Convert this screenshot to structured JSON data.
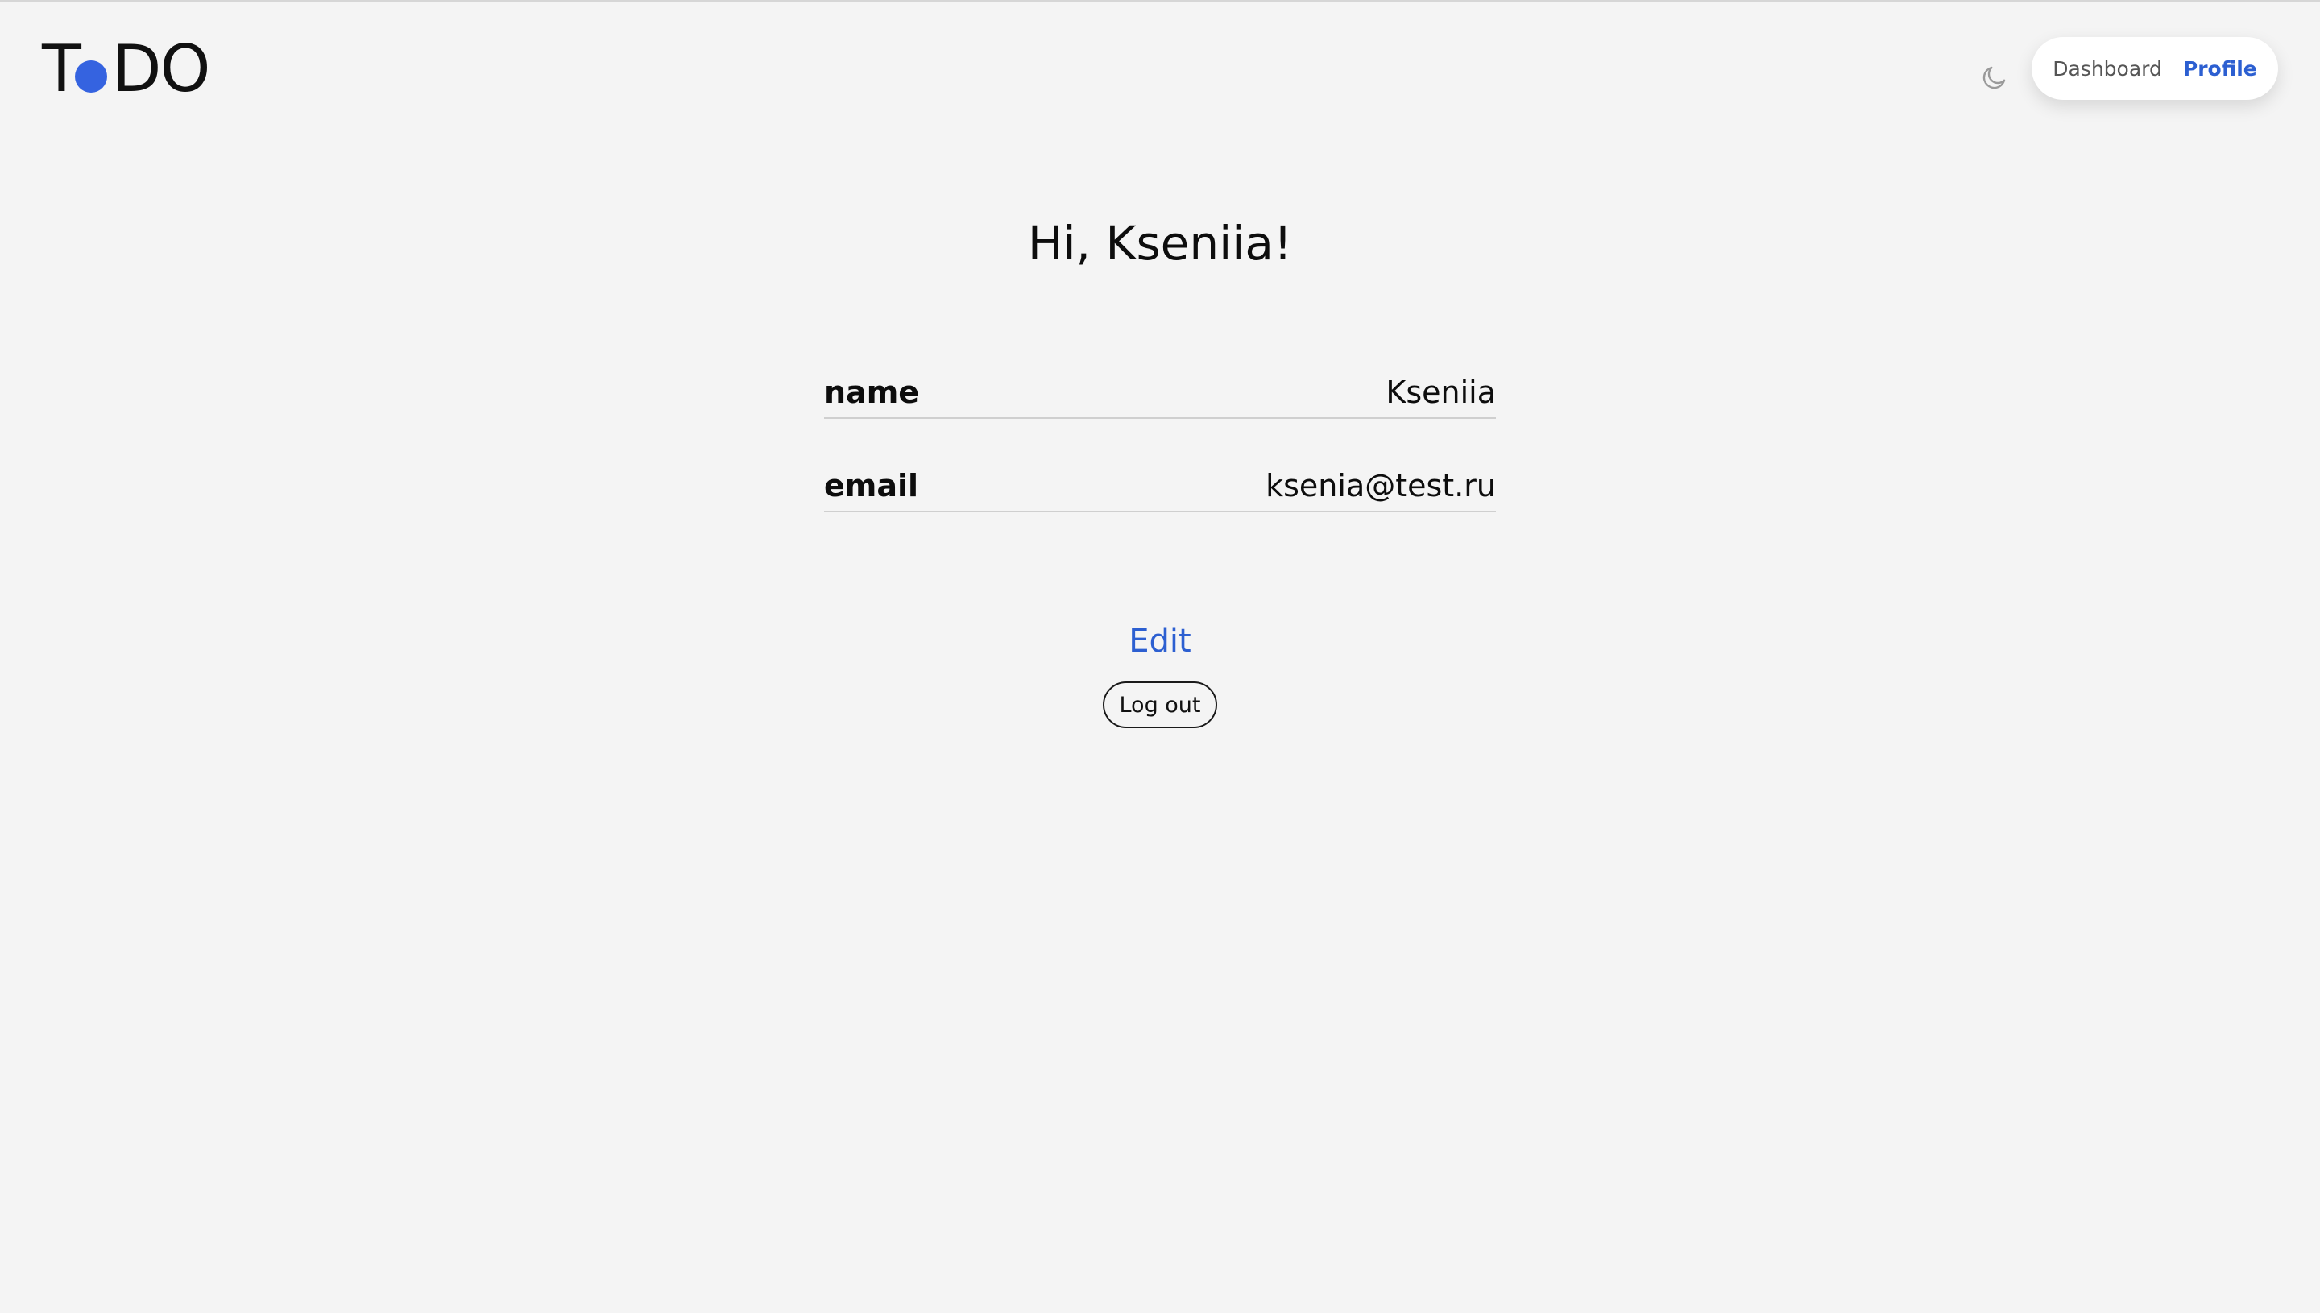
{
  "brand": {
    "logo_left": "T",
    "logo_right": "DO",
    "dot_color": "#3563e0"
  },
  "header": {
    "theme_icon": "moon-icon",
    "nav": {
      "dashboard_label": "Dashboard",
      "profile_label": "Profile",
      "active": "Profile"
    }
  },
  "profile": {
    "greeting": "Hi, Kseniia!",
    "fields": {
      "name": {
        "label": "name",
        "value": "Kseniia"
      },
      "email": {
        "label": "email",
        "value": "ksenia@test.ru"
      }
    },
    "edit_label": "Edit",
    "logout_label": "Log out"
  },
  "colors": {
    "accent": "#2c5fd1",
    "background": "#f4f4f4"
  }
}
